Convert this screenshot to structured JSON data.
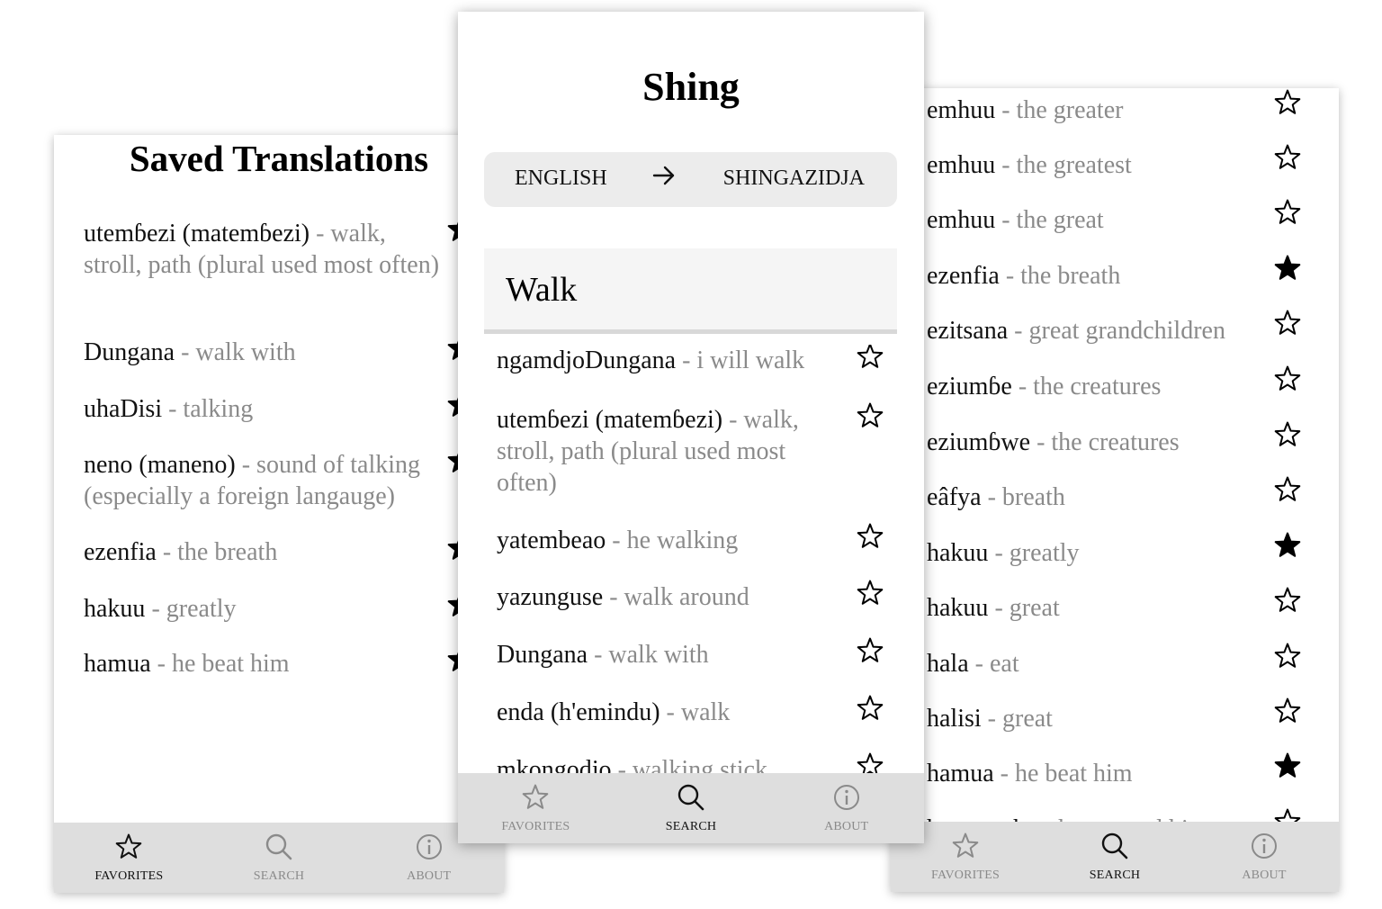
{
  "icons": {
    "star_outline": "star-outline-icon",
    "star_filled": "star-filled-icon",
    "search": "search-icon",
    "info": "info-icon",
    "arrow": "arrow-right-icon"
  },
  "tabs": [
    {
      "label": "FAVORITES",
      "icon": "star-outline-icon"
    },
    {
      "label": "SEARCH",
      "icon": "search-icon"
    },
    {
      "label": "ABOUT",
      "icon": "info-icon"
    }
  ],
  "favorites_screen": {
    "title": "Saved Translations",
    "active_tab": "FAVORITES",
    "items": [
      {
        "word": "utemɓezi (matemɓezi)",
        "def": " - walk, stroll, path (plural used most often)",
        "starred": true
      },
      {
        "word": "Dungana",
        "def": " - walk with",
        "starred": true
      },
      {
        "word": "uhaDisi",
        "def": " - talking",
        "starred": true
      },
      {
        "word": "neno (maneno)",
        "def": " - sound of talking (especially a foreign langauge)",
        "starred": true
      },
      {
        "word": "ezenfia",
        "def": " - the breath",
        "starred": true
      },
      {
        "word": "hakuu",
        "def": " - greatly",
        "starred": true
      },
      {
        "word": "hamua",
        "def": " - he beat him",
        "starred": true
      }
    ]
  },
  "search_screen": {
    "title": "Shing",
    "active_tab": "SEARCH",
    "lang_from": "ENGLISH",
    "lang_arrow": "→",
    "lang_to": "SHINGAZIDJA",
    "query": "Walk",
    "results": [
      {
        "word": "ngamdjoDungana",
        "def": " - i will walk",
        "starred": false
      },
      {
        "word": "utemɓezi (matemɓezi)",
        "def": " - walk, stroll, path (plural used most often)",
        "starred": false
      },
      {
        "word": "yatembeao",
        "def": " - he walking",
        "starred": false
      },
      {
        "word": "yazunguse",
        "def": " - walk around",
        "starred": false
      },
      {
        "word": "Dungana",
        "def": " - walk with",
        "starred": false
      },
      {
        "word": "enda (h'emindu)",
        "def": " - walk",
        "starred": false
      },
      {
        "word": "mkongodjo",
        "def": " - walking stick",
        "starred": false
      }
    ]
  },
  "browse_screen": {
    "active_tab": "SEARCH",
    "items": [
      {
        "word": "emhuu",
        "def": " - the greater",
        "starred": false
      },
      {
        "word": "emhuu",
        "def": " - the greatest",
        "starred": false
      },
      {
        "word": "emhuu",
        "def": " - the great",
        "starred": false
      },
      {
        "word": "ezenfia",
        "def": " - the breath",
        "starred": true
      },
      {
        "word": "ezitsana",
        "def": " - great grandchildren",
        "starred": false
      },
      {
        "word": "eziumɓe",
        "def": " - the creatures",
        "starred": false
      },
      {
        "word": "eziumɓwe",
        "def": " - the creatures",
        "starred": false
      },
      {
        "word": "eâfya",
        "def": " - breath",
        "starred": false
      },
      {
        "word": "hakuu",
        "def": " - greatly",
        "starred": true
      },
      {
        "word": "hakuu",
        "def": " - great",
        "starred": false
      },
      {
        "word": "hala",
        "def": " - eat",
        "starred": false
      },
      {
        "word": "halisi",
        "def": " - great",
        "starred": false
      },
      {
        "word": "hamua",
        "def": " - he beat him",
        "starred": true
      },
      {
        "word": "hamuamba",
        "def": " - he greeted him",
        "starred": false
      }
    ]
  }
}
